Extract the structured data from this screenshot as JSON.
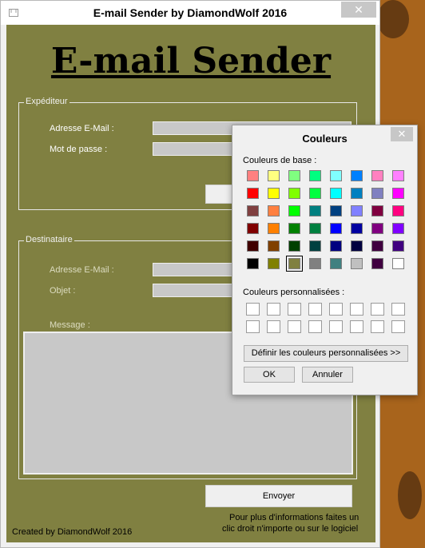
{
  "app": {
    "title": "E-mail Sender by DiamondWolf 2016",
    "heading": "E-mail Sender",
    "close_glyph": "✕",
    "icon": "app-icon"
  },
  "sender": {
    "legend": "Expéditeur",
    "email_label": "Adresse E-Mail :",
    "email_value": "",
    "password_label": "Mot de passe :",
    "password_value": ""
  },
  "recipient": {
    "legend": "Destinataire",
    "email_label": "Adresse E-Mail :",
    "email_value": "",
    "subject_label": "Objet :",
    "subject_value": "",
    "message_label": "Message :",
    "message_value": ""
  },
  "actions": {
    "send_label": "Envoyer"
  },
  "footer": {
    "credit": "Created by DiamondWolf 2016",
    "hint_line1": "Pour plus d'informations faites un",
    "hint_line2": "clic droit n'importe ou sur le logiciel"
  },
  "colors": {
    "form_background": "#808041",
    "desktop_background": "#a8641c"
  },
  "color_dialog": {
    "title": "Couleurs",
    "close_glyph": "✕",
    "basic_label": "Couleurs de base :",
    "custom_label": "Couleurs personnalisées :",
    "define_button": "Définir les couleurs personnalisées >>",
    "ok_button": "OK",
    "cancel_button": "Annuler",
    "selected_color": "#808040",
    "basic_colors": [
      [
        "#ff8080",
        "#ffff80",
        "#80ff80",
        "#00ff80",
        "#80ffff",
        "#0080ff",
        "#ff80c0",
        "#ff80ff"
      ],
      [
        "#ff0000",
        "#ffff00",
        "#80ff00",
        "#00ff40",
        "#00ffff",
        "#0080c0",
        "#8080c0",
        "#ff00ff"
      ],
      [
        "#804040",
        "#ff8040",
        "#00ff00",
        "#008080",
        "#004080",
        "#8080ff",
        "#800040",
        "#ff0080"
      ],
      [
        "#800000",
        "#ff8000",
        "#008000",
        "#008040",
        "#0000ff",
        "#0000a0",
        "#800080",
        "#8000ff"
      ],
      [
        "#400000",
        "#804000",
        "#004000",
        "#004040",
        "#000080",
        "#000040",
        "#400040",
        "#400080"
      ],
      [
        "#000000",
        "#808000",
        "#808040",
        "#808080",
        "#408080",
        "#c0c0c0",
        "#400040",
        "#ffffff"
      ]
    ],
    "custom_colors": [
      [
        "#ffffff",
        "#ffffff",
        "#ffffff",
        "#ffffff",
        "#ffffff",
        "#ffffff",
        "#ffffff",
        "#ffffff"
      ],
      [
        "#ffffff",
        "#ffffff",
        "#ffffff",
        "#ffffff",
        "#ffffff",
        "#ffffff",
        "#ffffff",
        "#ffffff"
      ]
    ]
  }
}
